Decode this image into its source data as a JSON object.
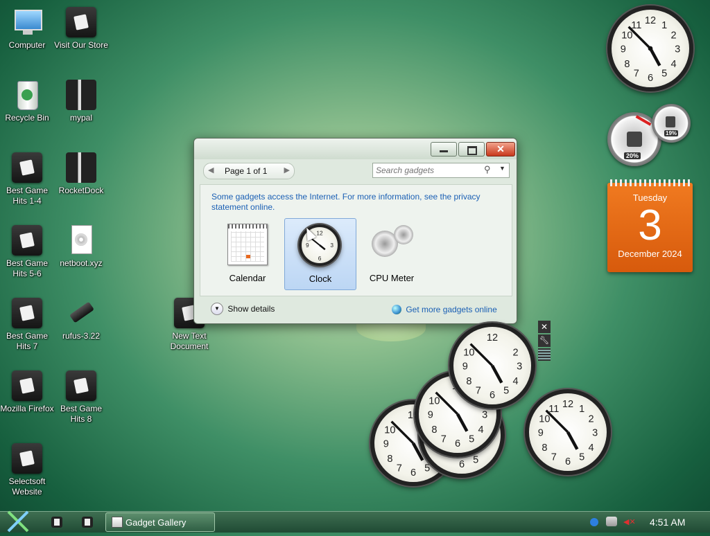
{
  "desktop_icons": [
    {
      "label": "Computer",
      "kind": "computer"
    },
    {
      "label": "Visit Our Store",
      "kind": "tile"
    },
    {
      "label": "Recycle Bin",
      "kind": "bin"
    },
    {
      "label": "mypal",
      "kind": "book"
    },
    {
      "label": "Best Game Hits 1-4",
      "kind": "tile"
    },
    {
      "label": "RocketDock",
      "kind": "book"
    },
    {
      "label": "Best Game Hits 5-6",
      "kind": "tile"
    },
    {
      "label": "netboot.xyz",
      "kind": "file"
    },
    {
      "label": "Best Game Hits 7",
      "kind": "tile"
    },
    {
      "label": "rufus-3.22",
      "kind": "usb"
    },
    {
      "label": "Mozilla Firefox",
      "kind": "tile"
    },
    {
      "label": "Best Game Hits 8",
      "kind": "tile"
    },
    {
      "label": "Selectsoft Website",
      "kind": "tile"
    },
    {
      "label": "New Text Document",
      "kind": "text"
    }
  ],
  "gallery": {
    "page_label": "Page 1 of 1",
    "search_placeholder": "Search gadgets",
    "notice": "Some gadgets access the Internet.  For more information, see the privacy statement online.",
    "gadgets": [
      {
        "label": "Calendar"
      },
      {
        "label": "Clock"
      },
      {
        "label": "CPU Meter"
      }
    ],
    "show_details": "Show details",
    "get_more": "Get more gadgets online"
  },
  "calendar_gadget": {
    "weekday": "Tuesday",
    "day": "3",
    "month_year": "December 2024"
  },
  "cpu_meter": {
    "cpu": "20%",
    "memory": "19%"
  },
  "taskbar": {
    "active_window": "Gadget Gallery",
    "time": "4:51 AM"
  }
}
